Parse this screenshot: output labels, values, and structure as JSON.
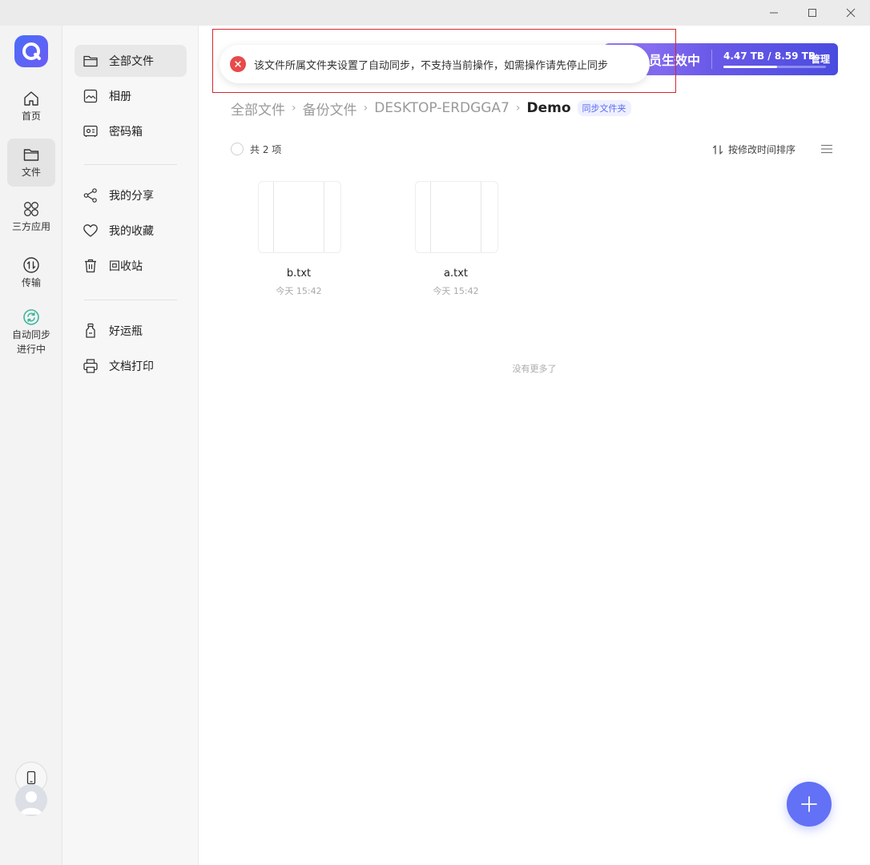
{
  "window": {
    "controls": [
      "minimize",
      "maximize",
      "close"
    ]
  },
  "rail": {
    "items": [
      {
        "label": "首页",
        "icon": "home-icon"
      },
      {
        "label": "文件",
        "icon": "folder-icon"
      },
      {
        "label": "三方应用",
        "icon": "apps-icon"
      },
      {
        "label": "传输",
        "icon": "transfer-icon"
      },
      {
        "label": "自动同步\n进行中",
        "label_line1": "自动同步",
        "label_line2": "进行中",
        "icon": "sync-icon"
      }
    ],
    "accent_color": "#3cb89b"
  },
  "sidebar": {
    "items": [
      {
        "label": "全部文件",
        "icon": "folder-icon"
      },
      {
        "label": "相册",
        "icon": "photo-icon"
      },
      {
        "label": "密码箱",
        "icon": "safe-icon"
      },
      {
        "label": "我的分享",
        "icon": "share-icon"
      },
      {
        "label": "我的收藏",
        "icon": "heart-icon"
      },
      {
        "label": "回收站",
        "icon": "trash-icon"
      },
      {
        "label": "好运瓶",
        "icon": "bottle-icon"
      },
      {
        "label": "文档打印",
        "icon": "printer-icon"
      }
    ]
  },
  "vip": {
    "status": "员生效中",
    "quota": "4.47 TB / 8.59 TB",
    "used_fraction": 0.52,
    "manage": "管理"
  },
  "toast": {
    "message": "该文件所属文件夹设置了自动同步，不支持当前操作，如需操作请先停止同步",
    "color": "#e84a4a"
  },
  "breadcrumb": {
    "items": [
      "全部文件",
      "备份文件",
      "DESKTOP-ERDGGA7"
    ],
    "current": "Demo",
    "tag": "同步文件夹"
  },
  "toolbar": {
    "count": "共 2 项",
    "sort": "按修改时间排序"
  },
  "files": [
    {
      "name": "b.txt",
      "time": "今天 15:42"
    },
    {
      "name": "a.txt",
      "time": "今天 15:42"
    }
  ],
  "list_end": "没有更多了",
  "accent_color": "#6271f5"
}
